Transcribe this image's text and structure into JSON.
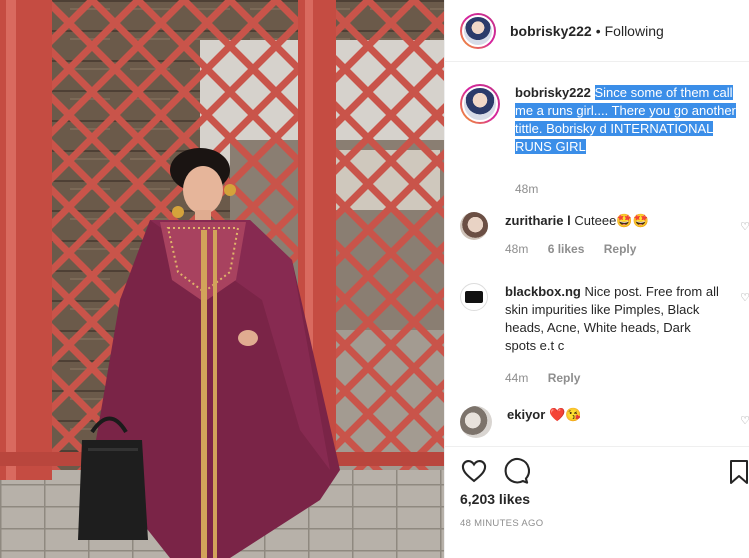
{
  "post": {
    "username": "bobrisky222",
    "separator": "•",
    "follow_status": "Following"
  },
  "caption": {
    "username": "bobrisky222",
    "text": "Since some of them call me a runs girl.... There you go another tittle. Bobrisky d INTERNATIONAL RUNS GIRL",
    "time": "48m"
  },
  "comments": [
    {
      "username": "zuritharie l",
      "display_username": "zuritharie l",
      "text": "Cuteee🤩🤩",
      "time": "48m",
      "likes": "6 likes",
      "reply": "Reply"
    },
    {
      "username": "blackbox.ng",
      "text": "Nice post. Free from all skin impurities like Pimples, Black heads, Acne, White heads, Dark spots e.t c",
      "time": "44m",
      "reply": "Reply"
    },
    {
      "username": "ekiyor",
      "text": "❤️😘"
    }
  ],
  "footer": {
    "likes": "6,203 likes",
    "time_ago": "48 MINUTES AGO"
  },
  "colors": {
    "highlight": "#3b8ee8",
    "muted": "#8e8e8e",
    "dress": "#7a2447"
  },
  "icons": [
    "heart-icon",
    "comment-icon",
    "bookmark-icon",
    "comment-like-icon"
  ]
}
